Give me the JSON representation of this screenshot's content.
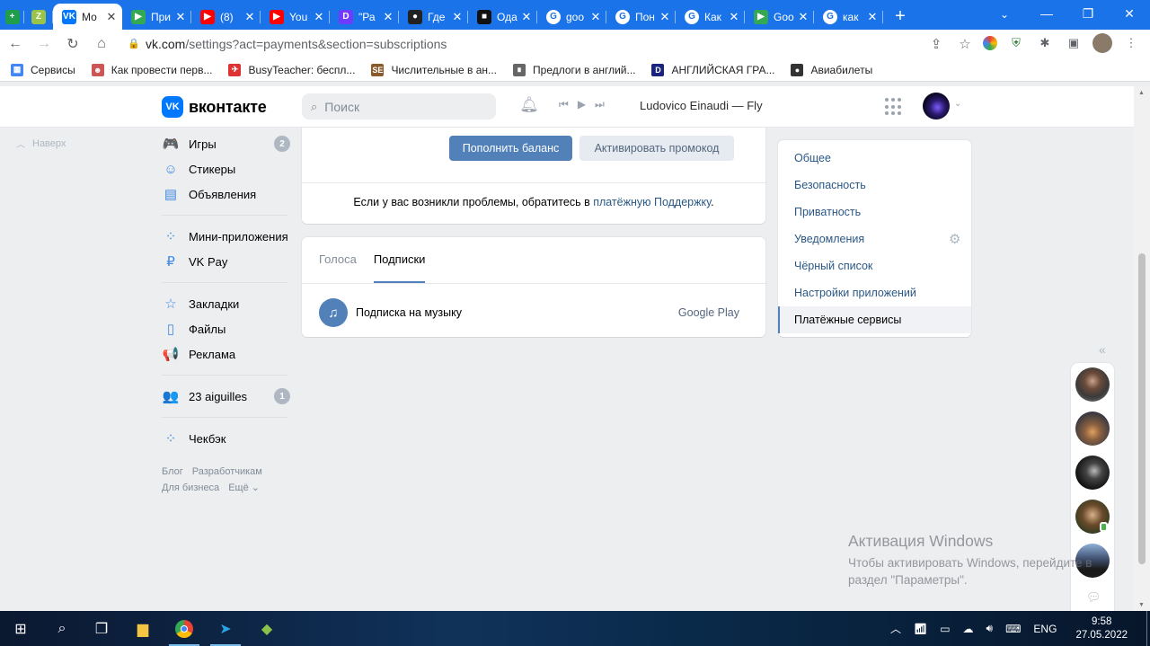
{
  "browser": {
    "tabs": [
      {
        "title": "",
        "icon": "plus-green",
        "color": "#1e9e4a",
        "pinned": true
      },
      {
        "title": "",
        "icon": "zoho-z",
        "color": "#9ac447",
        "pinned": true
      },
      {
        "title": "Мо",
        "icon": "vk",
        "color": "#0077ff",
        "active": true
      },
      {
        "title": "При",
        "icon": "play",
        "color": "#34a853"
      },
      {
        "title": "(8)",
        "icon": "youtube",
        "color": "#ff0000"
      },
      {
        "title": "You",
        "icon": "youtube",
        "color": "#ff0000"
      },
      {
        "title": "\"Ра",
        "icon": "d-letter",
        "color": "#6f3cff"
      },
      {
        "title": "Где",
        "icon": "avatar",
        "color": "#222222"
      },
      {
        "title": "Ода",
        "icon": "camera",
        "color": "#111111"
      },
      {
        "title": "goo",
        "icon": "google",
        "color": "#ffffff"
      },
      {
        "title": "Пон",
        "icon": "google",
        "color": "#ffffff"
      },
      {
        "title": "Как",
        "icon": "google",
        "color": "#ffffff"
      },
      {
        "title": "Goo",
        "icon": "play",
        "color": "#34a853"
      },
      {
        "title": "как",
        "icon": "google",
        "color": "#ffffff"
      }
    ],
    "url_main": "vk.com",
    "url_rest": "/settings?act=payments&section=subscriptions",
    "bookmarks": [
      {
        "label": "Сервисы",
        "color": "#4285f4"
      },
      {
        "label": "Как провести перв...",
        "color": "#c55"
      },
      {
        "label": "BusyTeacher: беспл...",
        "color": "#d33"
      },
      {
        "label": "Числительные в ан...",
        "color": "#8a5a2b"
      },
      {
        "label": "Предлоги в англий...",
        "color": "#666"
      },
      {
        "label": "АНГЛИЙСКАЯ ГРА...",
        "color": "#1a237e"
      },
      {
        "label": "Авиабилеты",
        "color": "#333"
      }
    ]
  },
  "vk": {
    "logo": "вконтакте",
    "search_placeholder": "Поиск",
    "track": "Ludovico Einaudi — Fly",
    "back_to_top": "Наверх",
    "menu": [
      {
        "label": "Игры",
        "icon": "gamepad-icon",
        "glyph": "🎮",
        "count": "2"
      },
      {
        "label": "Стикеры",
        "icon": "smile-icon",
        "glyph": "☺"
      },
      {
        "label": "Объявления",
        "icon": "classifieds-icon",
        "glyph": "▤"
      }
    ],
    "menu2": [
      {
        "label": "Мини-приложения",
        "icon": "apps-icon",
        "glyph": "⁘"
      },
      {
        "label": "VK Pay",
        "icon": "vkpay-icon",
        "glyph": "₽"
      }
    ],
    "menu3": [
      {
        "label": "Закладки",
        "icon": "star-icon",
        "glyph": "☆"
      },
      {
        "label": "Файлы",
        "icon": "file-icon",
        "glyph": "▯"
      },
      {
        "label": "Реклама",
        "icon": "megaphone-icon",
        "glyph": "📢"
      }
    ],
    "menu4": [
      {
        "label": "23 aiguilles",
        "icon": "group-icon",
        "glyph": "👥",
        "count": "1"
      }
    ],
    "menu5": [
      {
        "label": "Чекбэк",
        "icon": "apps-icon",
        "glyph": "⁘"
      }
    ],
    "footer": {
      "blog": "Блог",
      "dev": "Разработчикам",
      "biz": "Для бизнеса",
      "more": "Ещё ⌄"
    },
    "payments": {
      "topup": "Пополнить баланс",
      "promo": "Активировать промокод",
      "support_prefix": "Если у вас возникли проблемы, обратитесь в ",
      "support_link": "платёжную Поддержку",
      "support_suffix": "."
    },
    "subs": {
      "tabs": [
        "Голоса",
        "Подписки"
      ],
      "active_tab": "Подписки",
      "item_name": "Подписка на музыку",
      "item_source": "Google Play"
    },
    "settings_menu": [
      "Общее",
      "Безопасность",
      "Приватность",
      "Уведомления",
      "Чёрный список",
      "Настройки приложений",
      "Платёжные сервисы"
    ],
    "settings_active": "Платёжные сервисы"
  },
  "watermark": {
    "title": "Активация Windows",
    "line1": "Чтобы активировать Windows, перейдите в",
    "line2": "раздел \"Параметры\"."
  },
  "taskbar": {
    "lang": "ENG",
    "time": "9:58",
    "date": "27.05.2022"
  }
}
